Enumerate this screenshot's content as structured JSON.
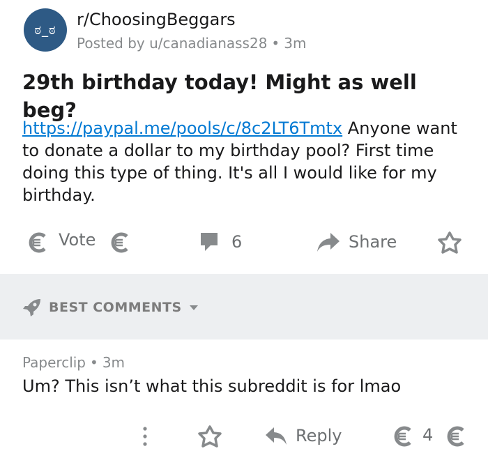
{
  "post": {
    "avatar_text": "ಠ_ಠ",
    "subreddit": "r/ChoosingBeggars",
    "posted_by": "Posted by u/canadianass28",
    "separator": "•",
    "age": "3m",
    "title": "29th birthday today! Might as well beg?",
    "link": "https://paypal.me/pools/c/8c2LT6Tmtx",
    "body": " Anyone want to donate a dollar to my birthday pool? First time doing this type of thing. It's all I would like for my birthday."
  },
  "actions": {
    "vote_label": "Vote",
    "comment_count": "6",
    "share_label": "Share"
  },
  "comments_header": {
    "label": "BEST COMMENTS"
  },
  "comment": {
    "author": "Paperclip",
    "separator": "•",
    "age": "3m",
    "text": "Um? This isn’t what this subreddit is for lmao",
    "reply_label": "Reply",
    "score": "4"
  },
  "colors": {
    "link": "#0079d3",
    "avatar_bg": "#2e5a85",
    "icon_gray": "#878a8c",
    "section_bg": "#edeff1"
  }
}
